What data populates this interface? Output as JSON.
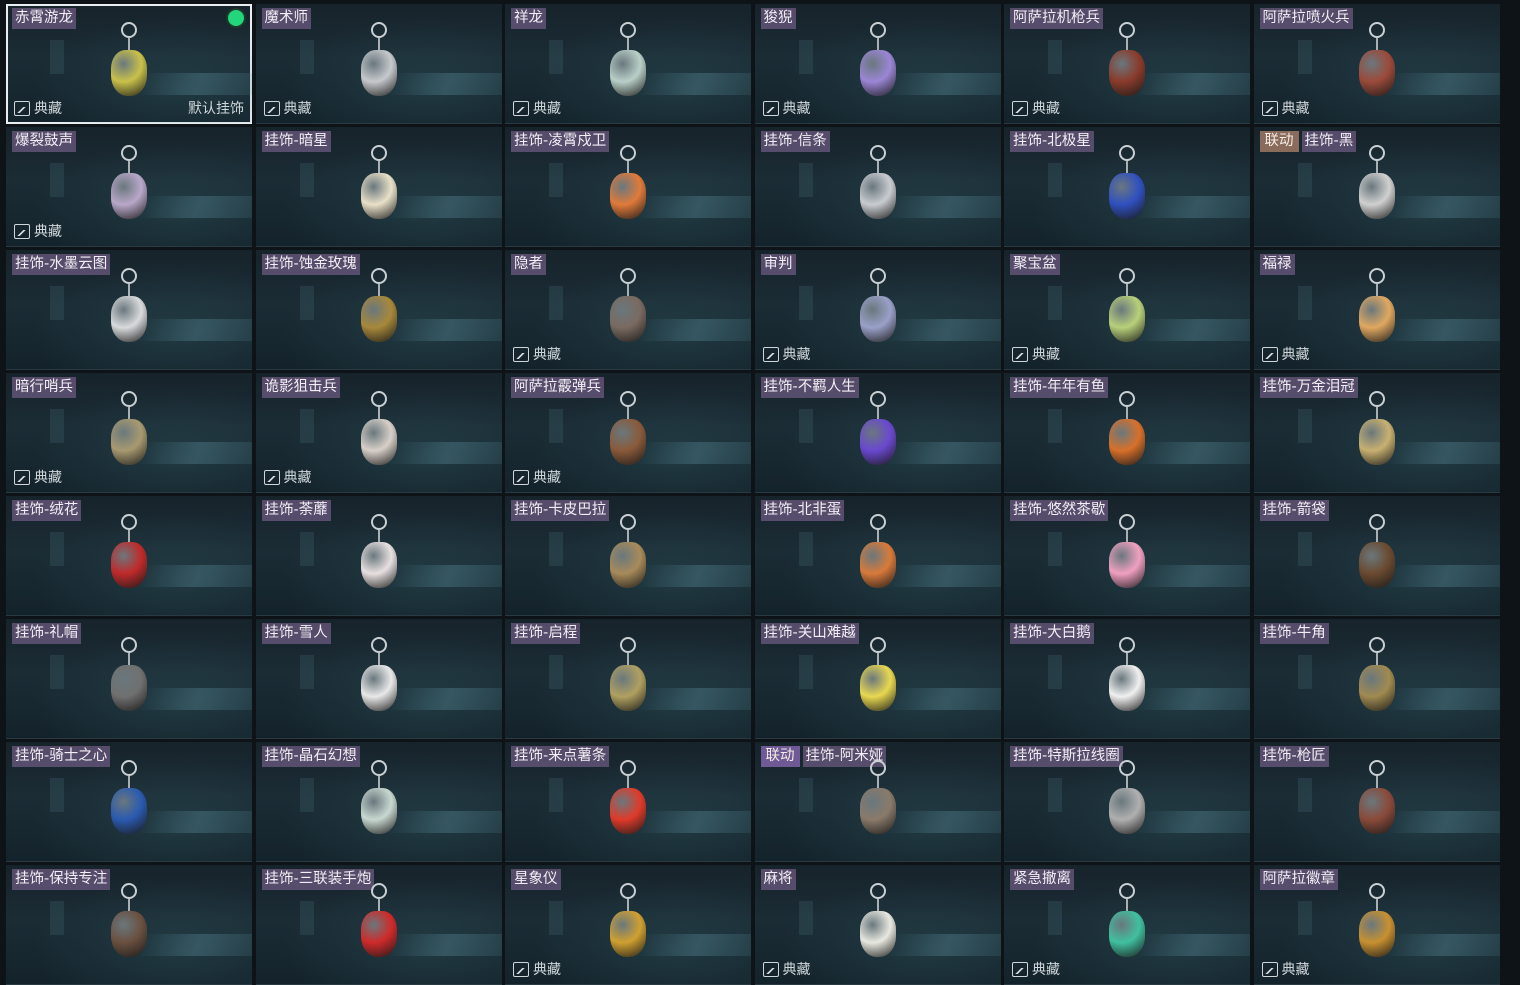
{
  "collection_label": "典藏",
  "default_label": "默认挂饰",
  "items": [
    {
      "name": "赤霄游龙",
      "collection": true,
      "default": true,
      "equipped": true,
      "color": "#c9c14a",
      "icon": "dragon-charm-icon"
    },
    {
      "name": "魔术师",
      "collection": true,
      "color": "#c6c9cc",
      "icon": "magician-card-icon"
    },
    {
      "name": "祥龙",
      "collection": true,
      "color": "#b9cfc8",
      "icon": "auspicious-dragon-icon"
    },
    {
      "name": "狻猊",
      "collection": true,
      "color": "#9b86d6",
      "icon": "lion-beast-icon"
    },
    {
      "name": "阿萨拉机枪兵",
      "collection": true,
      "color": "#8a3b2b",
      "icon": "gunner-figure-icon"
    },
    {
      "name": "阿萨拉喷火兵",
      "collection": true,
      "color": "#9c4a3a",
      "icon": "flamethrower-figure-icon"
    },
    {
      "name": "爆裂鼓声",
      "collection": true,
      "color": "#b8a7c9",
      "icon": "drummer-figure-icon"
    },
    {
      "name": "挂饰-暗星",
      "color": "#e8e0c8",
      "icon": "dark-star-icon"
    },
    {
      "name": "挂饰-凌霄戍卫",
      "color": "#e07a3a",
      "icon": "rocket-icon"
    },
    {
      "name": "挂饰-信条",
      "color": "#c8ccd0",
      "icon": "creed-icon"
    },
    {
      "name": "挂饰-北极星",
      "color": "#3050c0",
      "icon": "north-star-icon"
    },
    {
      "name": "挂饰-黑",
      "collab": "联动",
      "color": "#d0d0d0",
      "icon": "lighter-icon"
    },
    {
      "name": "挂饰-水墨云图",
      "color": "#d8dadc",
      "icon": "disco-ball-icon"
    },
    {
      "name": "挂饰-蚀金玫瑰",
      "color": "#a8883a",
      "icon": "golden-rose-icon"
    },
    {
      "name": "隐者",
      "collection": true,
      "color": "#7a6a60",
      "icon": "hermit-card-icon"
    },
    {
      "name": "审判",
      "collection": true,
      "color": "#9aa0c8",
      "icon": "judgement-card-icon"
    },
    {
      "name": "聚宝盆",
      "collection": true,
      "color": "#b8d07a",
      "icon": "treasure-bowl-icon"
    },
    {
      "name": "福禄",
      "collection": true,
      "color": "#e0a860",
      "icon": "gourd-icon"
    },
    {
      "name": "暗行哨兵",
      "collection": true,
      "color": "#a89a70",
      "icon": "sentinel-figure-icon"
    },
    {
      "name": "诡影狙击兵",
      "collection": true,
      "color": "#d8d0c8",
      "icon": "sniper-figure-icon"
    },
    {
      "name": "阿萨拉霰弹兵",
      "collection": true,
      "color": "#8a5a3a",
      "icon": "shotgunner-figure-icon"
    },
    {
      "name": "挂饰-不羁人生",
      "color": "#6a48d0",
      "icon": "sneaker-icon"
    },
    {
      "name": "挂饰-年年有鱼",
      "color": "#d8702a",
      "icon": "fish-icon"
    },
    {
      "name": "挂饰-万金泪冠",
      "color": "#c8b070",
      "icon": "crown-icon"
    },
    {
      "name": "挂饰-绒花",
      "color": "#c02a2a",
      "icon": "rose-icon"
    },
    {
      "name": "挂饰-荼蘼",
      "color": "#e8e0e0",
      "icon": "flower-icon"
    },
    {
      "name": "挂饰-卡皮巴拉",
      "color": "#a88a5a",
      "icon": "capybara-icon"
    },
    {
      "name": "挂饰-北非蛋",
      "color": "#d87a3a",
      "icon": "shakshuka-icon"
    },
    {
      "name": "挂饰-悠然茶歇",
      "color": "#f0a0c0",
      "icon": "cupcake-icon"
    },
    {
      "name": "挂饰-箭袋",
      "color": "#6a4a30",
      "icon": "quiver-icon"
    },
    {
      "name": "挂饰-礼帽",
      "color": "#707070",
      "icon": "top-hat-icon"
    },
    {
      "name": "挂饰-雪人",
      "color": "#e8e8e8",
      "icon": "snowman-icon"
    },
    {
      "name": "挂饰-启程",
      "color": "#b0a060",
      "icon": "compass-badge-icon"
    },
    {
      "name": "挂饰-关山难越",
      "color": "#e8d850",
      "icon": "snack-bar-icon"
    },
    {
      "name": "挂饰-大白鹅",
      "color": "#f0f0f0",
      "icon": "goose-icon"
    },
    {
      "name": "挂饰-牛角",
      "color": "#a08a50",
      "icon": "bull-horns-icon"
    },
    {
      "name": "挂饰-骑士之心",
      "color": "#2a5ab0",
      "icon": "knight-shield-icon"
    },
    {
      "name": "挂饰-晶石幻想",
      "color": "#c8d8d0",
      "icon": "crystal-icon"
    },
    {
      "name": "挂饰-来点薯条",
      "color": "#e03a2a",
      "icon": "fries-icon"
    },
    {
      "name": "挂饰-阿米娅",
      "collab": "联动",
      "collab_style": "purple",
      "color": "#8a7a6a",
      "icon": "amiya-figure-icon"
    },
    {
      "name": "挂饰-特斯拉线圈",
      "color": "#b0b0b0",
      "icon": "tesla-coil-icon"
    },
    {
      "name": "挂饰-枪匠",
      "color": "#8a4a3a",
      "icon": "gunsmith-box-icon"
    },
    {
      "name": "挂饰-保持专注",
      "color": "#6a5040",
      "icon": "stay-focused-icon"
    },
    {
      "name": "挂饰-三联装手炮",
      "color": "#d02a2a",
      "icon": "hand-cannon-icon"
    },
    {
      "name": "星象仪",
      "collection": true,
      "color": "#d0a030",
      "icon": "astrolabe-icon"
    },
    {
      "name": "麻将",
      "collection": true,
      "color": "#e8e8e0",
      "icon": "mahjong-tile-icon"
    },
    {
      "name": "紧急撤离",
      "collection": true,
      "color": "#40c0a0",
      "icon": "evac-badge-icon"
    },
    {
      "name": "阿萨拉徽章",
      "collection": true,
      "color": "#c89030",
      "icon": "asala-badge-icon"
    }
  ]
}
